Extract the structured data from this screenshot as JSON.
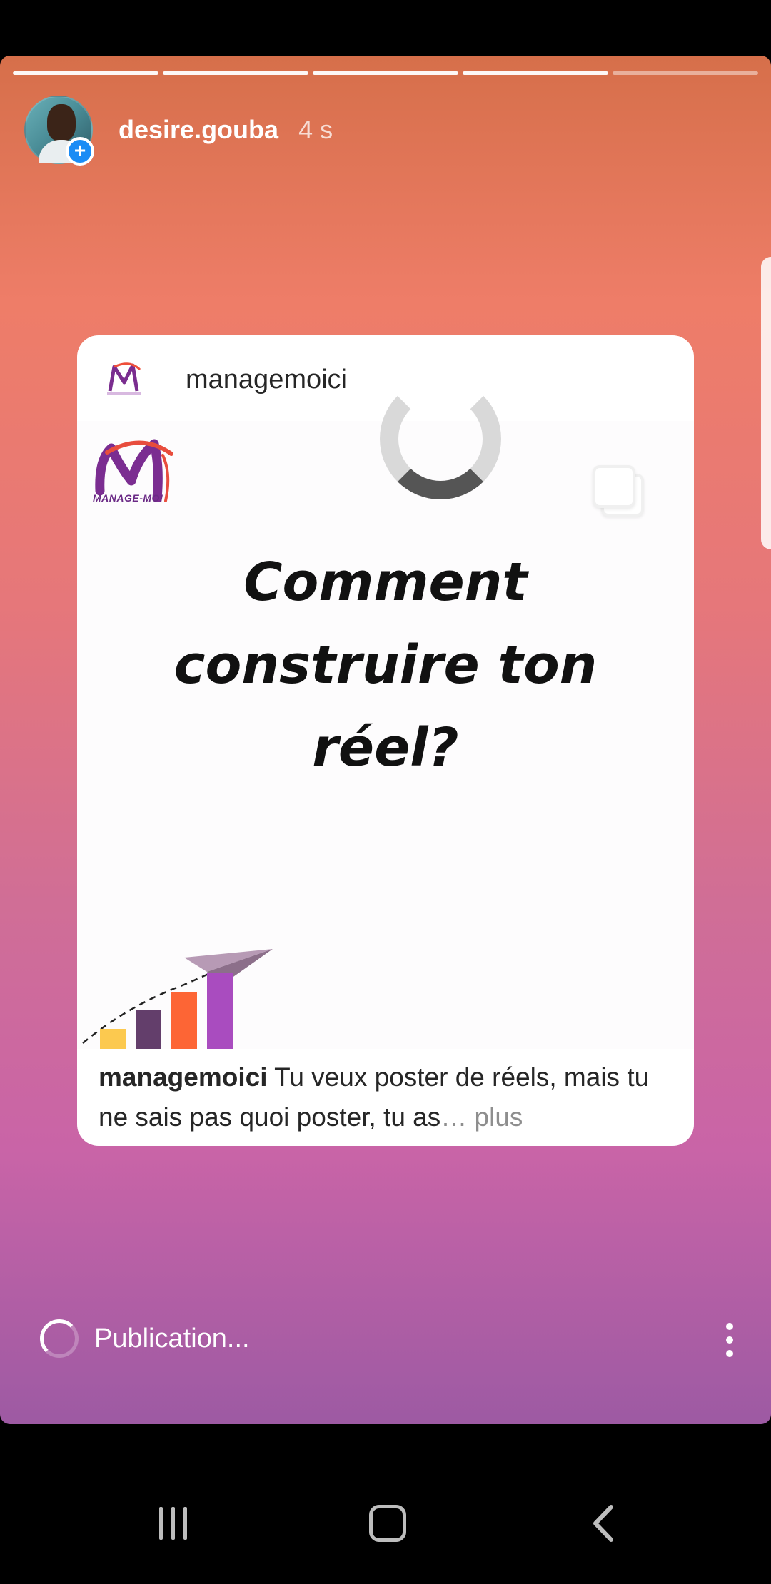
{
  "story": {
    "username": "desire.gouba",
    "time_ago": "4 s",
    "progress": {
      "total_segments": 5,
      "completed_segments": 4
    }
  },
  "post_card": {
    "username": "managemoici",
    "headline": "Comment\nconstruire ton\nréel?",
    "brand_logo_text": "MANAGE-MOI",
    "caption_user": "managemoici",
    "caption_text": " Tu veux poster de réels, mais tu ne sais pas quoi poster, tu as",
    "caption_ellipsis": "…",
    "caption_more": " plus"
  },
  "footer": {
    "status_text": "Publication..."
  },
  "colors": {
    "brand_purple": "#6b2a86",
    "bar_yellow": "#fcc94f",
    "bar_plum": "#633e6b",
    "bar_orange": "#fd6535",
    "bar_violet": "#a94cbf",
    "plus_blue": "#1a8cf5"
  },
  "icons": {
    "avatar_plus": "+",
    "menu": "more-vertical-icon",
    "nav_recent": "recent-apps-icon",
    "nav_home": "home-icon",
    "nav_back": "back-icon"
  }
}
